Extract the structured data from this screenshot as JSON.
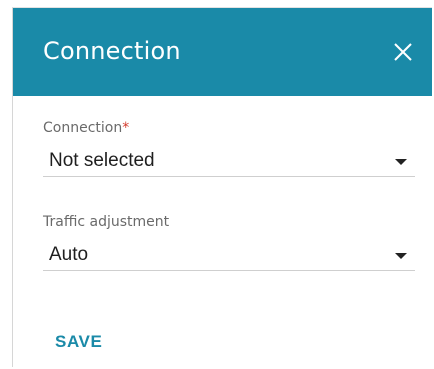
{
  "dialog": {
    "title": "Connection",
    "close_icon": "close-icon"
  },
  "fields": {
    "connection": {
      "label": "Connection",
      "required_marker": "*",
      "value": "Not selected"
    },
    "traffic_adjustment": {
      "label": "Traffic adjustment",
      "value": "Auto"
    }
  },
  "actions": {
    "save_label": "SAVE"
  },
  "colors": {
    "accent": "#1a8aa8",
    "required": "#d33a2c"
  }
}
